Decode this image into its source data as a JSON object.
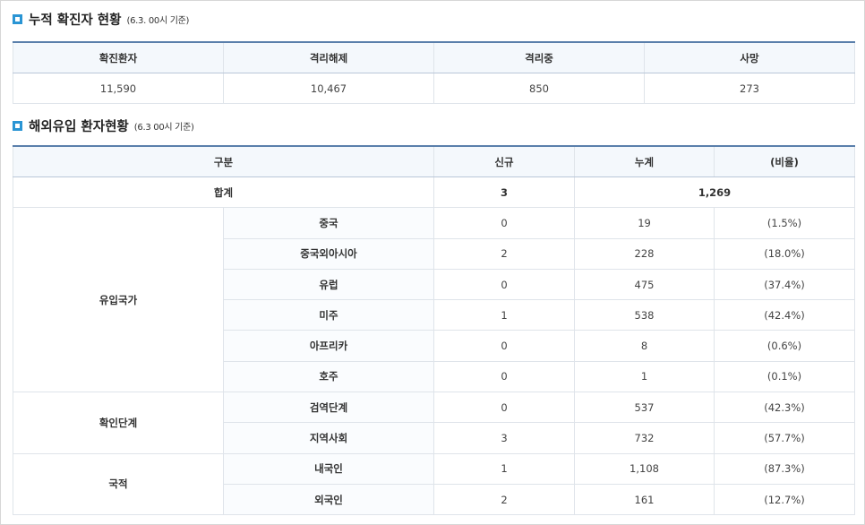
{
  "section1": {
    "title": "누적 확진자 현황",
    "subtitle": "(6.3. 00시 기준)",
    "headers": [
      "확진환자",
      "격리해제",
      "격리중",
      "사망"
    ],
    "values": [
      "11,590",
      "10,467",
      "850",
      "273"
    ]
  },
  "section2": {
    "title": "해외유입 환자현황",
    "subtitle": "(6.3 00시 기준)",
    "headers": [
      "구분",
      "신규",
      "누계",
      "(비율)"
    ],
    "total": {
      "label": "합계",
      "new": "3",
      "cumulative": "1,269"
    },
    "groups": [
      {
        "name": "유입국가",
        "rows": [
          {
            "label": "중국",
            "new": "0",
            "cumulative": "19",
            "ratio": "(1.5%)"
          },
          {
            "label": "중국외아시아",
            "new": "2",
            "cumulative": "228",
            "ratio": "(18.0%)"
          },
          {
            "label": "유럽",
            "new": "0",
            "cumulative": "475",
            "ratio": "(37.4%)"
          },
          {
            "label": "미주",
            "new": "1",
            "cumulative": "538",
            "ratio": "(42.4%)"
          },
          {
            "label": "아프리카",
            "new": "0",
            "cumulative": "8",
            "ratio": "(0.6%)"
          },
          {
            "label": "호주",
            "new": "0",
            "cumulative": "1",
            "ratio": "(0.1%)"
          }
        ]
      },
      {
        "name": "확인단계",
        "rows": [
          {
            "label": "검역단계",
            "new": "0",
            "cumulative": "537",
            "ratio": "(42.3%)"
          },
          {
            "label": "지역사회",
            "new": "3",
            "cumulative": "732",
            "ratio": "(57.7%)"
          }
        ]
      },
      {
        "name": "국적",
        "rows": [
          {
            "label": "내국인",
            "new": "1",
            "cumulative": "1,108",
            "ratio": "(87.3%)"
          },
          {
            "label": "외국인",
            "new": "2",
            "cumulative": "161",
            "ratio": "(12.7%)"
          }
        ]
      }
    ]
  },
  "colors": {
    "accent": "#2a95d4",
    "header_bg": "#f4f8fc",
    "header_border": "#5a7fab"
  }
}
